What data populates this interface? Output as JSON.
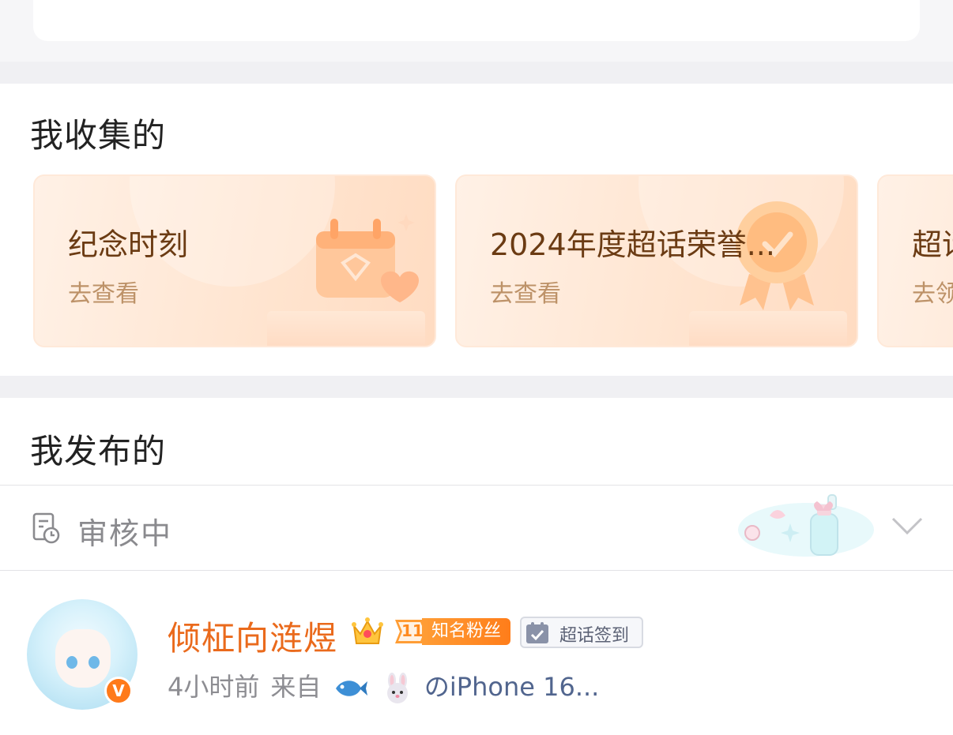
{
  "sections": {
    "collected_title": "我收集的",
    "published_title": "我发布的"
  },
  "collected_cards": [
    {
      "title": "纪念时刻",
      "action": "去查看"
    },
    {
      "title": "2024年度超话荣誉...",
      "action": "去查看"
    },
    {
      "title": "超话",
      "action": "去领"
    }
  ],
  "review": {
    "label": "审核中",
    "icon": "document-clock-icon"
  },
  "post": {
    "username": "倾柾向涟煜",
    "fan_level": "11",
    "fan_badge": "知名粉丝",
    "checkin_badge": "超话签到",
    "verified_mark": "V",
    "time": "4小时前",
    "from_label": "来自",
    "device": "のiPhone 16..."
  },
  "colors": {
    "accent_orange": "#ea6a1c",
    "card_bg": "#ffe4cf",
    "device_blue": "#51658e"
  }
}
